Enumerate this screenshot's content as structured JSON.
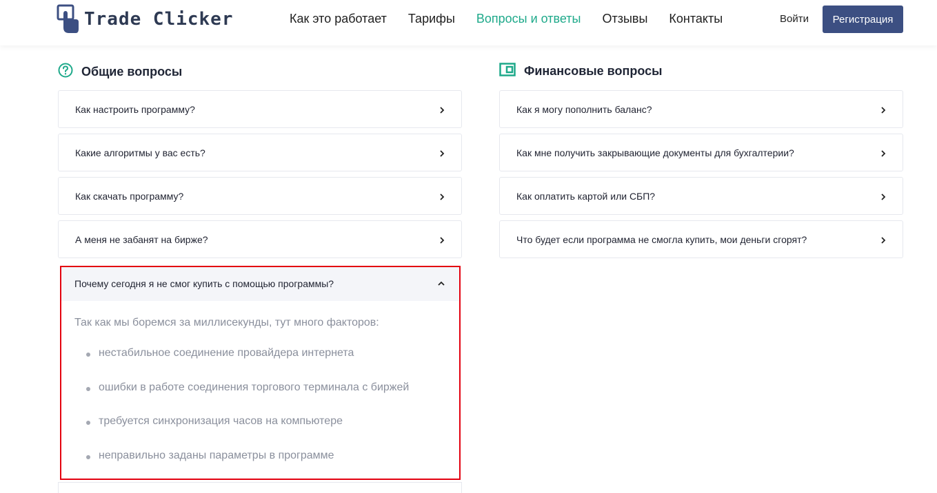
{
  "brand": {
    "name": "Trade Clicker"
  },
  "nav": {
    "items": [
      {
        "label": "Как это работает",
        "active": false
      },
      {
        "label": "Тарифы",
        "active": false
      },
      {
        "label": "Вопросы и ответы",
        "active": true
      },
      {
        "label": "Отзывы",
        "active": false
      },
      {
        "label": "Контакты",
        "active": false
      }
    ],
    "login_label": "Войти",
    "register_label": "Регистрация"
  },
  "colors": {
    "accent": "#1ea98a",
    "primary_button": "#3c4f82",
    "highlight_border": "#e3000f"
  },
  "general": {
    "title": "Общие вопросы",
    "icon": "question-circle-icon",
    "questions": [
      "Как настроить программу?",
      "Какие алгоритмы у вас есть?",
      "Как скачать программу?",
      "А меня не забанят на бирже?"
    ],
    "expanded": {
      "question": "Почему сегодня я не смог купить с помощью программы?",
      "intro": "Так как мы боремся за миллисекунды, тут много факторов:",
      "items": [
        "нестабильное соединение провайдера интернета",
        "ошибки в работе соединения торгового терминала с биржей",
        "требуется синхронизация часов на компьютере",
        "неправильно заданы параметры в программе"
      ]
    }
  },
  "finance": {
    "title": "Финансовые вопросы",
    "icon": "wallet-icon",
    "questions": [
      "Как я могу пополнить баланс?",
      "Как мне получить закрывающие документы для бухгалтерии?",
      "Как оплатить картой или СБП?",
      "Что будет если программа не смогла купить, мои деньги сгорят?"
    ]
  }
}
